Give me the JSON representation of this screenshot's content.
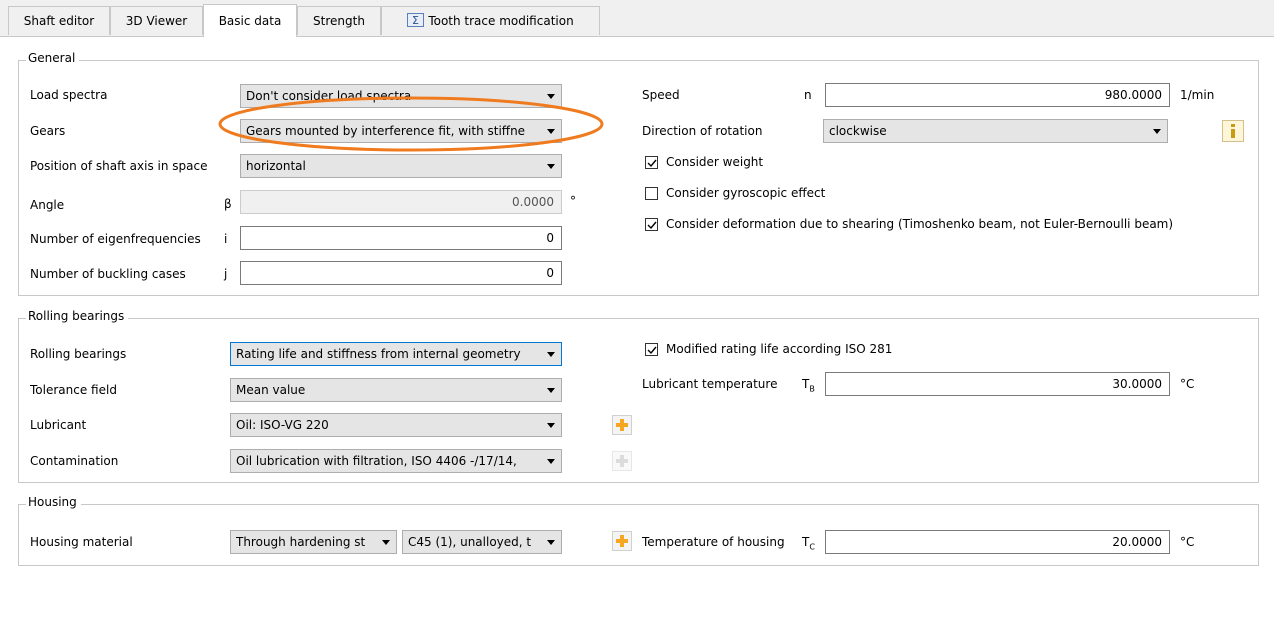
{
  "tabs": [
    {
      "label": "Shaft editor"
    },
    {
      "label": "3D Viewer"
    },
    {
      "label": "Basic data"
    },
    {
      "label": "Strength"
    },
    {
      "label": "Tooth trace modification"
    }
  ],
  "general": {
    "title": "General",
    "load_spectra": {
      "label": "Load spectra",
      "value": "Don't consider load spectra"
    },
    "gears": {
      "label": "Gears",
      "value": "Gears mounted by interference fit, with stiffne"
    },
    "position_axis": {
      "label": "Position of shaft axis in space",
      "value": "horizontal"
    },
    "angle": {
      "label": "Angle",
      "symbol": "β",
      "value": "0.0000",
      "unit": "°"
    },
    "eigenfrequencies": {
      "label": "Number of eigenfrequencies",
      "symbol": "i",
      "value": "0"
    },
    "buckling": {
      "label": "Number of buckling cases",
      "symbol": "j",
      "value": "0"
    },
    "speed": {
      "label": "Speed",
      "symbol": "n",
      "value": "980.0000",
      "unit": "1/min"
    },
    "rotation": {
      "label": "Direction of rotation",
      "value": "clockwise"
    },
    "consider_weight": {
      "label": "Consider weight",
      "checked": true
    },
    "gyroscopic": {
      "label": "Consider gyroscopic effect",
      "checked": false
    },
    "shearing": {
      "label": "Consider deformation due to shearing (Timoshenko beam, not Euler-Bernoulli beam)",
      "checked": true
    }
  },
  "rolling": {
    "title": "Rolling bearings",
    "bearings": {
      "label": "Rolling bearings",
      "value": "Rating life and stiffness from internal geometry"
    },
    "tolerance": {
      "label": "Tolerance field",
      "value": "Mean value"
    },
    "lubricant": {
      "label": "Lubricant",
      "value": "Oil: ISO-VG 220"
    },
    "contamination": {
      "label": "Contamination",
      "value": "Oil lubrication with filtration, ISO 4406 -/17/14,"
    },
    "modified_life": {
      "label": "Modified rating life according ISO 281",
      "checked": true
    },
    "lub_temp": {
      "label": "Lubricant temperature",
      "symbol": "T",
      "sub": "B",
      "value": "30.0000",
      "unit": "°C"
    }
  },
  "housing": {
    "title": "Housing",
    "material": {
      "label": "Housing material",
      "value1": "Through hardening st",
      "value2": "C45 (1), unalloyed, t"
    },
    "temp": {
      "label": "Temperature of housing",
      "symbol": "T",
      "sub": "C",
      "value": "20.0000",
      "unit": "°C"
    }
  },
  "colors": {
    "highlight": "#f07b1e",
    "plus": "#f5a623",
    "info": "#c89b10"
  }
}
